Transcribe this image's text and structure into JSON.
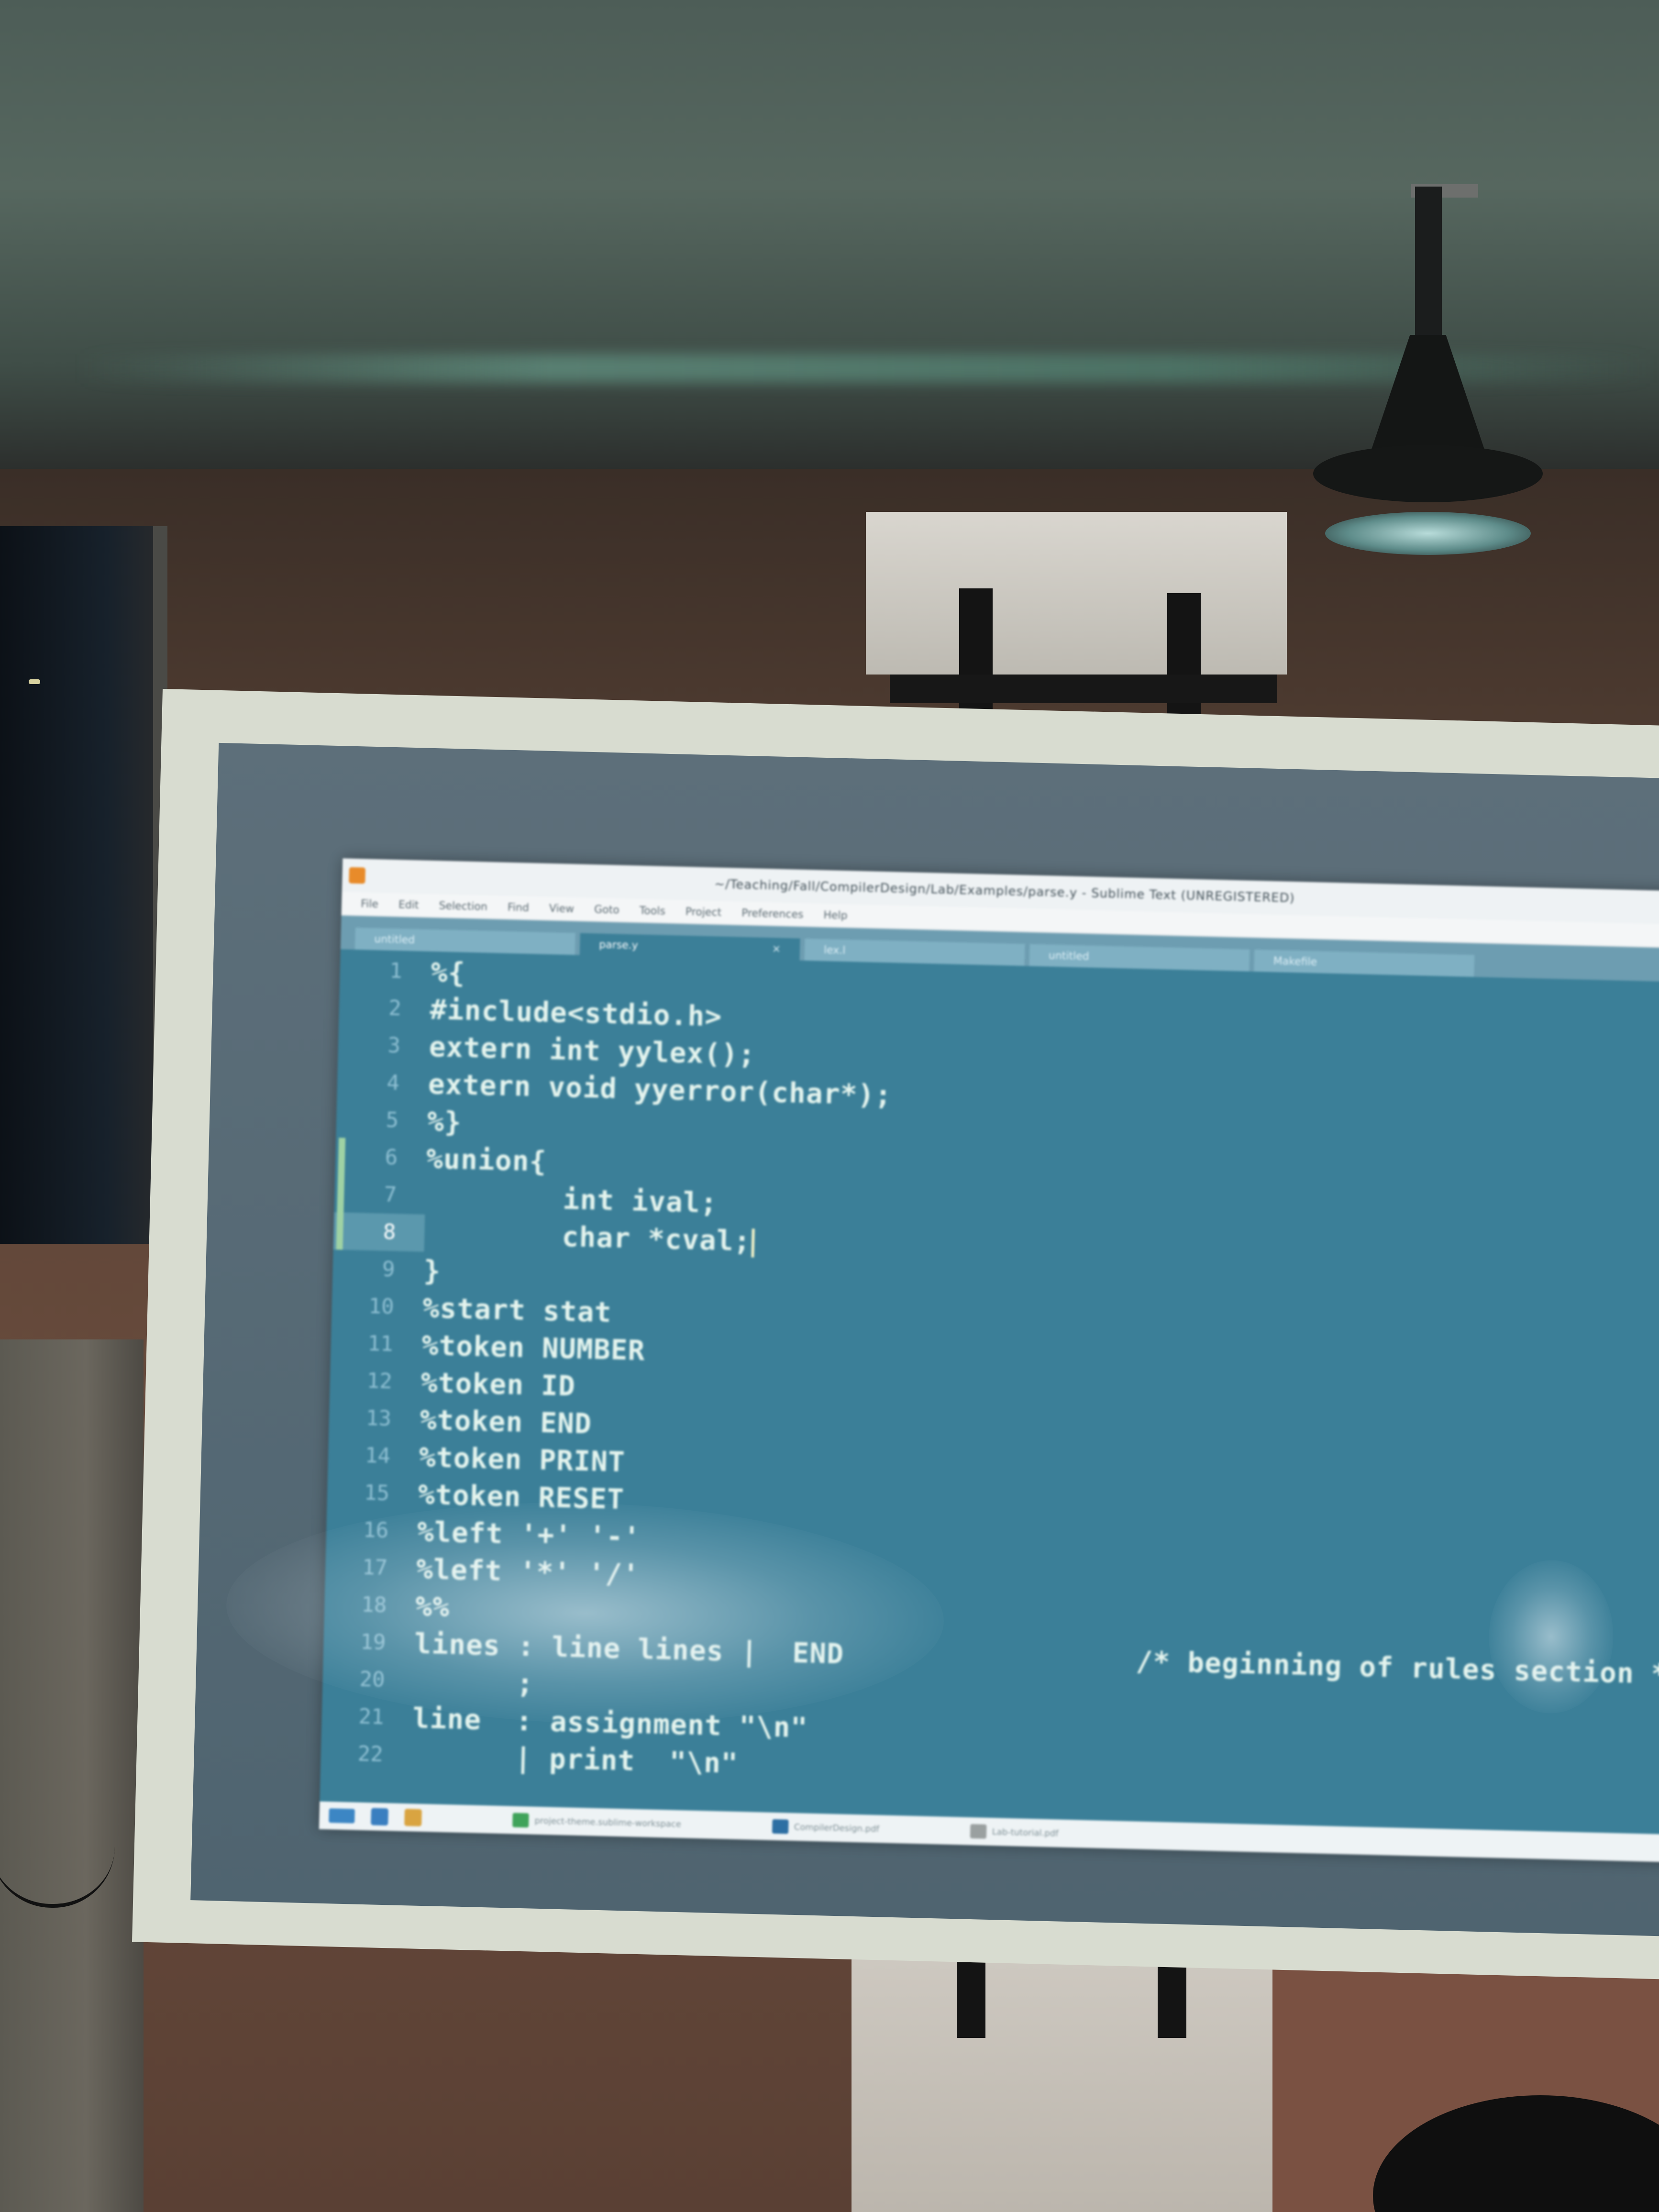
{
  "window": {
    "title": "~/Teaching/Fall/CompilerDesign/Lab/Examples/parse.y - Sublime Text (UNREGISTERED)"
  },
  "menu": [
    {
      "label": "File"
    },
    {
      "label": "Edit"
    },
    {
      "label": "Selection"
    },
    {
      "label": "Find"
    },
    {
      "label": "View"
    },
    {
      "label": "Goto"
    },
    {
      "label": "Tools"
    },
    {
      "label": "Project"
    },
    {
      "label": "Preferences"
    },
    {
      "label": "Help"
    }
  ],
  "tabs": [
    {
      "label": "untitled",
      "active": false
    },
    {
      "label": "parse.y",
      "active": true
    },
    {
      "label": "lex.l",
      "active": false
    },
    {
      "label": "untitled",
      "active": false
    },
    {
      "label": "Makefile",
      "active": false
    }
  ],
  "editor": {
    "current_line": 8,
    "modified_lines": [
      6,
      7,
      8
    ],
    "lines": [
      {
        "num": "1",
        "text": "%{"
      },
      {
        "num": "2",
        "text": "#include<stdio.h>"
      },
      {
        "num": "3",
        "text": "extern int yylex();"
      },
      {
        "num": "4",
        "text": "extern void yyerror(char*);"
      },
      {
        "num": "5",
        "text": "%}"
      },
      {
        "num": "6",
        "text": "%union{"
      },
      {
        "num": "7",
        "text": "        int ival;"
      },
      {
        "num": "8",
        "text": "        char *cval;"
      },
      {
        "num": "9",
        "text": "}"
      },
      {
        "num": "10",
        "text": "%start stat"
      },
      {
        "num": "11",
        "text": "%token NUMBER"
      },
      {
        "num": "12",
        "text": "%token ID"
      },
      {
        "num": "13",
        "text": "%token END"
      },
      {
        "num": "14",
        "text": "%token PRINT"
      },
      {
        "num": "15",
        "text": "%token RESET"
      },
      {
        "num": "16",
        "text": "%left '+' '-'"
      },
      {
        "num": "17",
        "text": "%left '*' '/'"
      },
      {
        "num": "18",
        "text": "%%"
      },
      {
        "num": "19",
        "text": "lines : line lines |  END                 /* beginning of rules section */"
      },
      {
        "num": "20",
        "text": "      ;"
      },
      {
        "num": "21",
        "text": "line  : assignment \"\\n\""
      },
      {
        "num": "22",
        "text": "      | print  \"\\n\""
      }
    ]
  },
  "taskbar": {
    "items": [
      {
        "label": "project-theme.sublime-workspace",
        "icon": "terminal-icon",
        "color": "#3fa35a"
      },
      {
        "label": "CompilerDesign.pdf",
        "icon": "folder-icon",
        "color": "#2d6fa3"
      },
      {
        "label": "Lab-tutorial.pdf",
        "icon": "document-icon",
        "color": "#9aa0a0"
      }
    ]
  },
  "colors": {
    "editor_bg": "#3b7f98",
    "code_text": "#e4f4ee",
    "gutter_text": "#8fc0d3",
    "modified_marker": "#9fd2a4",
    "app_icon": "#e88b2a"
  }
}
